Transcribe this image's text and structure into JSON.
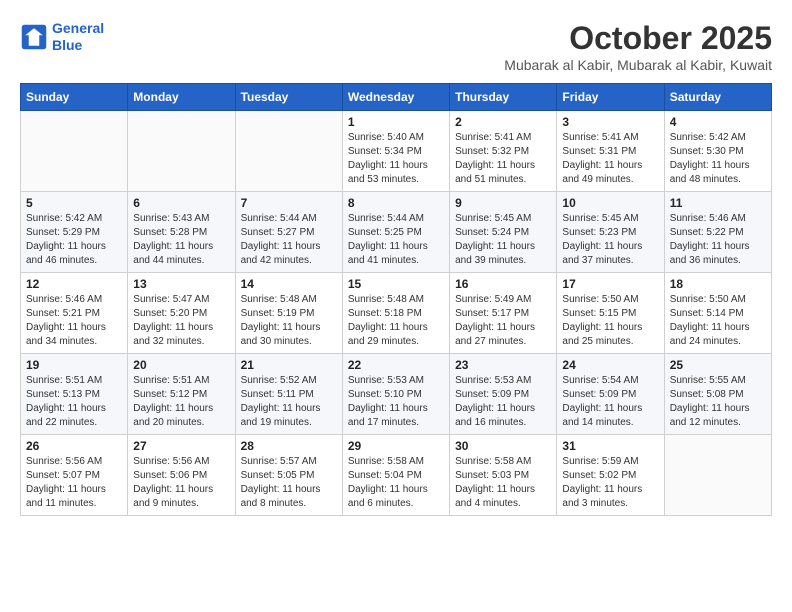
{
  "header": {
    "logo_line1": "General",
    "logo_line2": "Blue",
    "month": "October 2025",
    "location": "Mubarak al Kabir, Mubarak al Kabir, Kuwait"
  },
  "weekdays": [
    "Sunday",
    "Monday",
    "Tuesday",
    "Wednesday",
    "Thursday",
    "Friday",
    "Saturday"
  ],
  "weeks": [
    [
      {
        "day": "",
        "info": ""
      },
      {
        "day": "",
        "info": ""
      },
      {
        "day": "",
        "info": ""
      },
      {
        "day": "1",
        "info": "Sunrise: 5:40 AM\nSunset: 5:34 PM\nDaylight: 11 hours\nand 53 minutes."
      },
      {
        "day": "2",
        "info": "Sunrise: 5:41 AM\nSunset: 5:32 PM\nDaylight: 11 hours\nand 51 minutes."
      },
      {
        "day": "3",
        "info": "Sunrise: 5:41 AM\nSunset: 5:31 PM\nDaylight: 11 hours\nand 49 minutes."
      },
      {
        "day": "4",
        "info": "Sunrise: 5:42 AM\nSunset: 5:30 PM\nDaylight: 11 hours\nand 48 minutes."
      }
    ],
    [
      {
        "day": "5",
        "info": "Sunrise: 5:42 AM\nSunset: 5:29 PM\nDaylight: 11 hours\nand 46 minutes."
      },
      {
        "day": "6",
        "info": "Sunrise: 5:43 AM\nSunset: 5:28 PM\nDaylight: 11 hours\nand 44 minutes."
      },
      {
        "day": "7",
        "info": "Sunrise: 5:44 AM\nSunset: 5:27 PM\nDaylight: 11 hours\nand 42 minutes."
      },
      {
        "day": "8",
        "info": "Sunrise: 5:44 AM\nSunset: 5:25 PM\nDaylight: 11 hours\nand 41 minutes."
      },
      {
        "day": "9",
        "info": "Sunrise: 5:45 AM\nSunset: 5:24 PM\nDaylight: 11 hours\nand 39 minutes."
      },
      {
        "day": "10",
        "info": "Sunrise: 5:45 AM\nSunset: 5:23 PM\nDaylight: 11 hours\nand 37 minutes."
      },
      {
        "day": "11",
        "info": "Sunrise: 5:46 AM\nSunset: 5:22 PM\nDaylight: 11 hours\nand 36 minutes."
      }
    ],
    [
      {
        "day": "12",
        "info": "Sunrise: 5:46 AM\nSunset: 5:21 PM\nDaylight: 11 hours\nand 34 minutes."
      },
      {
        "day": "13",
        "info": "Sunrise: 5:47 AM\nSunset: 5:20 PM\nDaylight: 11 hours\nand 32 minutes."
      },
      {
        "day": "14",
        "info": "Sunrise: 5:48 AM\nSunset: 5:19 PM\nDaylight: 11 hours\nand 30 minutes."
      },
      {
        "day": "15",
        "info": "Sunrise: 5:48 AM\nSunset: 5:18 PM\nDaylight: 11 hours\nand 29 minutes."
      },
      {
        "day": "16",
        "info": "Sunrise: 5:49 AM\nSunset: 5:17 PM\nDaylight: 11 hours\nand 27 minutes."
      },
      {
        "day": "17",
        "info": "Sunrise: 5:50 AM\nSunset: 5:15 PM\nDaylight: 11 hours\nand 25 minutes."
      },
      {
        "day": "18",
        "info": "Sunrise: 5:50 AM\nSunset: 5:14 PM\nDaylight: 11 hours\nand 24 minutes."
      }
    ],
    [
      {
        "day": "19",
        "info": "Sunrise: 5:51 AM\nSunset: 5:13 PM\nDaylight: 11 hours\nand 22 minutes."
      },
      {
        "day": "20",
        "info": "Sunrise: 5:51 AM\nSunset: 5:12 PM\nDaylight: 11 hours\nand 20 minutes."
      },
      {
        "day": "21",
        "info": "Sunrise: 5:52 AM\nSunset: 5:11 PM\nDaylight: 11 hours\nand 19 minutes."
      },
      {
        "day": "22",
        "info": "Sunrise: 5:53 AM\nSunset: 5:10 PM\nDaylight: 11 hours\nand 17 minutes."
      },
      {
        "day": "23",
        "info": "Sunrise: 5:53 AM\nSunset: 5:09 PM\nDaylight: 11 hours\nand 16 minutes."
      },
      {
        "day": "24",
        "info": "Sunrise: 5:54 AM\nSunset: 5:09 PM\nDaylight: 11 hours\nand 14 minutes."
      },
      {
        "day": "25",
        "info": "Sunrise: 5:55 AM\nSunset: 5:08 PM\nDaylight: 11 hours\nand 12 minutes."
      }
    ],
    [
      {
        "day": "26",
        "info": "Sunrise: 5:56 AM\nSunset: 5:07 PM\nDaylight: 11 hours\nand 11 minutes."
      },
      {
        "day": "27",
        "info": "Sunrise: 5:56 AM\nSunset: 5:06 PM\nDaylight: 11 hours\nand 9 minutes."
      },
      {
        "day": "28",
        "info": "Sunrise: 5:57 AM\nSunset: 5:05 PM\nDaylight: 11 hours\nand 8 minutes."
      },
      {
        "day": "29",
        "info": "Sunrise: 5:58 AM\nSunset: 5:04 PM\nDaylight: 11 hours\nand 6 minutes."
      },
      {
        "day": "30",
        "info": "Sunrise: 5:58 AM\nSunset: 5:03 PM\nDaylight: 11 hours\nand 4 minutes."
      },
      {
        "day": "31",
        "info": "Sunrise: 5:59 AM\nSunset: 5:02 PM\nDaylight: 11 hours\nand 3 minutes."
      },
      {
        "day": "",
        "info": ""
      }
    ]
  ]
}
